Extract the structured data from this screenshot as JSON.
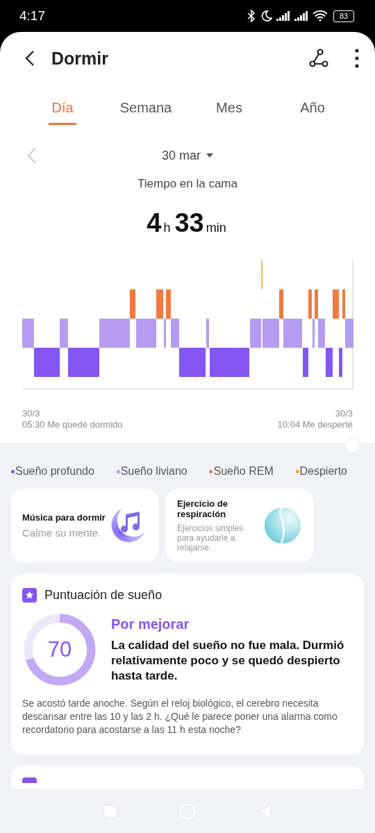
{
  "status_bar": {
    "time": "4:17",
    "battery": "83"
  },
  "header": {
    "title": "Dormir"
  },
  "tabs": [
    {
      "label": "Día",
      "selected": true
    },
    {
      "label": "Semana",
      "selected": false
    },
    {
      "label": "Mes",
      "selected": false
    },
    {
      "label": "Año",
      "selected": false
    }
  ],
  "date": "30 mar",
  "summary": {
    "label": "Tiempo en la cama",
    "hours": "4",
    "hours_unit": "h",
    "minutes": "33",
    "minutes_unit": "min"
  },
  "chart": {
    "start_date": "30/3",
    "start_text": "05:30 Me quedé dormido",
    "end_date": "30/3",
    "end_text": "10:04 Me desperté"
  },
  "legend": [
    {
      "label": "Sueño profundo",
      "color": "#8455f0"
    },
    {
      "label": "Sueño liviano",
      "color": "#b59cf2"
    },
    {
      "label": "Sueño REM",
      "color": "#f07a40"
    },
    {
      "label": "Despierto",
      "color": "#f4a030"
    }
  ],
  "cards": [
    {
      "kind": "music",
      "title": "Música para dormir",
      "subtitle": "Calme su mente."
    },
    {
      "kind": "breathing",
      "title": "Ejercicio de respiración",
      "subtitle": "Ejercicios simples para ayudarle a relajarse."
    }
  ],
  "score": {
    "title": "Puntuación de sueño",
    "value": "70",
    "rating": "Por mejorar",
    "summary": "La calidad del sueño no fue mala. Durmió relativamente poco y se quedó despierto hasta tarde.",
    "advice": "Se acostó tarde anoche. Según el reloj biológico, el cerebro necesita descansar entre las 10 y las 2 h. ¿Qué le parece poner una alarma como recordatorio para acostarse a las 11 h esta noche?"
  }
}
